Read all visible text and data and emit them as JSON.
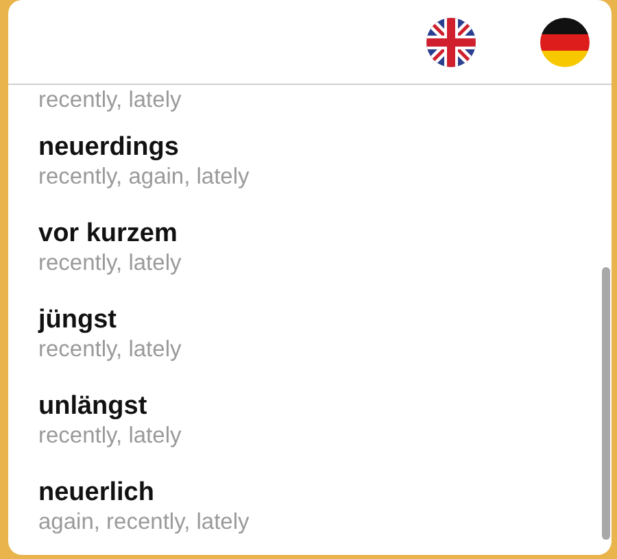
{
  "header": {
    "flags": [
      {
        "kind": "uk"
      },
      {
        "kind": "de"
      }
    ]
  },
  "entries": [
    {
      "translation": "recently, lately"
    },
    {
      "word": "neuerdings",
      "translation": "recently, again, lately"
    },
    {
      "word": "vor kurzem",
      "translation": "recently, lately"
    },
    {
      "word": "jüngst",
      "translation": "recently, lately"
    },
    {
      "word": "unlängst",
      "translation": "recently, lately"
    },
    {
      "word": "neuerlich",
      "translation": "again, recently, lately"
    }
  ]
}
